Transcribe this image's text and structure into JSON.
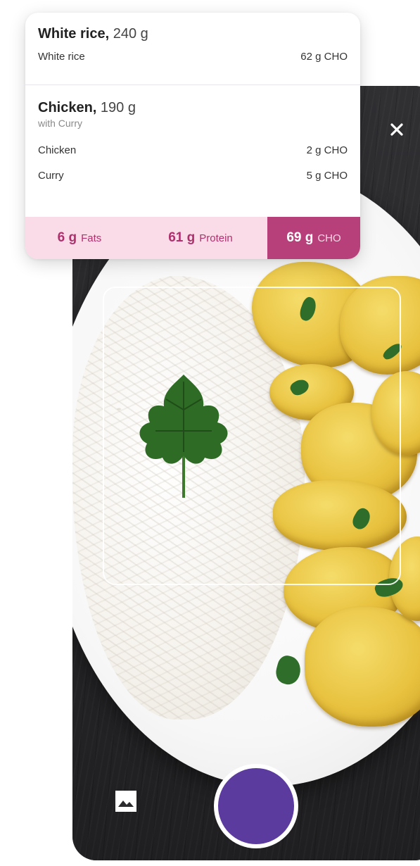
{
  "colors": {
    "accent": "#5b3c9e",
    "pink_light": "#f9dce8",
    "pink_dark": "#b8407a",
    "pink_text": "#b0306e"
  },
  "food_items": [
    {
      "name": "White rice,",
      "weight": "240 g",
      "note": "",
      "ingredients": [
        {
          "name": "White rice",
          "cho": "62 g CHO"
        }
      ]
    },
    {
      "name": "Chicken,",
      "weight": "190 g",
      "note": "with Curry",
      "ingredients": [
        {
          "name": "Chicken",
          "cho": "2 g CHO"
        },
        {
          "name": "Curry",
          "cho": "5 g CHO"
        }
      ]
    }
  ],
  "totals": {
    "fats": {
      "value": "6 g",
      "label": "Fats"
    },
    "protein": {
      "value": "61 g",
      "label": "Protein"
    },
    "cho": {
      "value": "69 g",
      "label": "CHO"
    }
  },
  "icons": {
    "close": "close-icon",
    "gallery": "image-gallery-icon",
    "shutter": "shutter-button"
  }
}
